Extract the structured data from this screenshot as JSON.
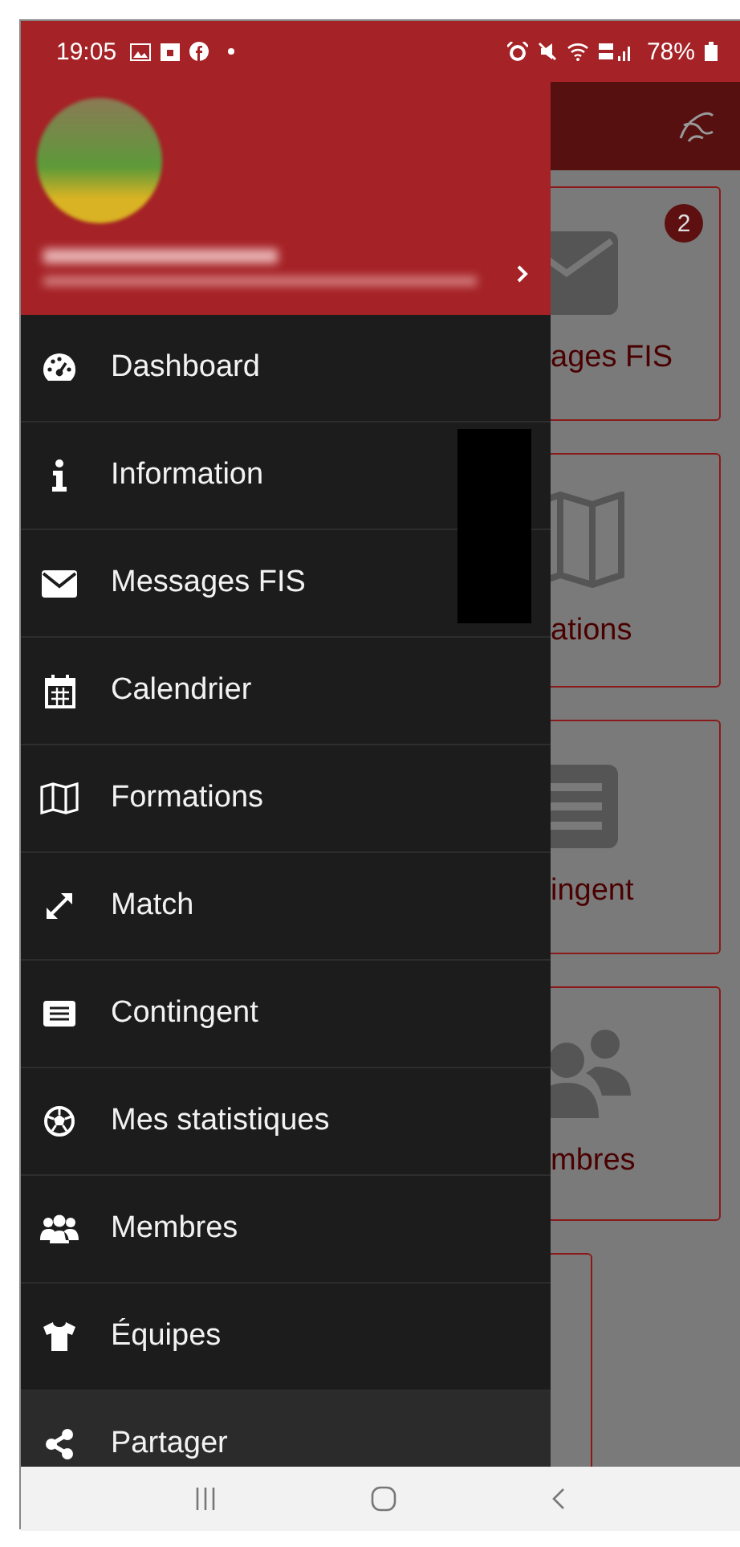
{
  "status_bar": {
    "time": "19:05",
    "battery": "78%"
  },
  "drawer": {
    "items": [
      {
        "label": "Dashboard",
        "selected": false
      },
      {
        "label": "Information",
        "selected": false
      },
      {
        "label": "Messages FIS",
        "selected": false
      },
      {
        "label": "Calendrier",
        "selected": false
      },
      {
        "label": "Formations",
        "selected": false
      },
      {
        "label": "Match",
        "selected": false
      },
      {
        "label": "Contingent",
        "selected": false
      },
      {
        "label": "Mes statistiques",
        "selected": false
      },
      {
        "label": "Membres",
        "selected": false
      },
      {
        "label": "Équipes",
        "selected": false
      },
      {
        "label": "Partager",
        "selected": true
      }
    ]
  },
  "background": {
    "tiles": [
      {
        "label": "ages FIS",
        "badge": "2"
      },
      {
        "label": "ations"
      },
      {
        "label": "ingent"
      },
      {
        "label": "mbres"
      }
    ]
  }
}
